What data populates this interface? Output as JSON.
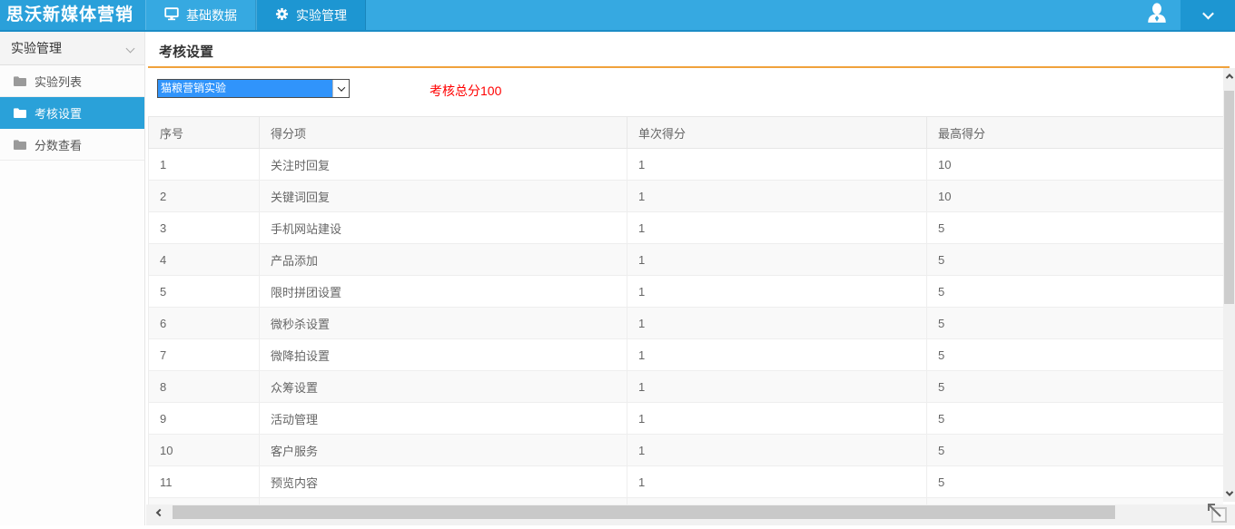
{
  "topbar": {
    "logo": "思沃新媒体营销",
    "tabs": [
      {
        "label": "基础数据",
        "icon": "monitor-icon",
        "active": false
      },
      {
        "label": "实验管理",
        "icon": "gear-icon",
        "active": true
      }
    ]
  },
  "sidebar": {
    "header": {
      "label": "实验管理",
      "icon": "chevron-down-icon"
    },
    "items": [
      {
        "label": "实验列表",
        "icon": "folder-icon",
        "active": false
      },
      {
        "label": "考核设置",
        "icon": "folder-icon",
        "active": true
      },
      {
        "label": "分数查看",
        "icon": "folder-icon",
        "active": false
      }
    ]
  },
  "main": {
    "title": "考核设置",
    "experiment_select": {
      "value": "猫粮营销实验"
    },
    "total_score_text": "考核总分100",
    "table": {
      "headers": [
        "序号",
        "得分项",
        "单次得分",
        "最高得分"
      ],
      "rows": [
        [
          "1",
          "关注时回复",
          "1",
          "10"
        ],
        [
          "2",
          "关键词回复",
          "1",
          "10"
        ],
        [
          "3",
          "手机网站建设",
          "1",
          "5"
        ],
        [
          "4",
          "产品添加",
          "1",
          "5"
        ],
        [
          "5",
          "限时拼团设置",
          "1",
          "5"
        ],
        [
          "6",
          "微秒杀设置",
          "1",
          "5"
        ],
        [
          "7",
          "微降拍设置",
          "1",
          "5"
        ],
        [
          "8",
          "众筹设置",
          "1",
          "5"
        ],
        [
          "9",
          "活动管理",
          "1",
          "5"
        ],
        [
          "10",
          "客户服务",
          "1",
          "5"
        ],
        [
          "11",
          "预览内容",
          "1",
          "5"
        ]
      ]
    }
  },
  "colors": {
    "topbar_blue": "#36a9e1",
    "topbar_active_blue": "#1d96d2",
    "sidebar_active_blue": "#2aa1d9",
    "divider_orange": "#f0a23c",
    "score_red": "#ff0000",
    "select_highlight_blue": "#3094fb"
  }
}
